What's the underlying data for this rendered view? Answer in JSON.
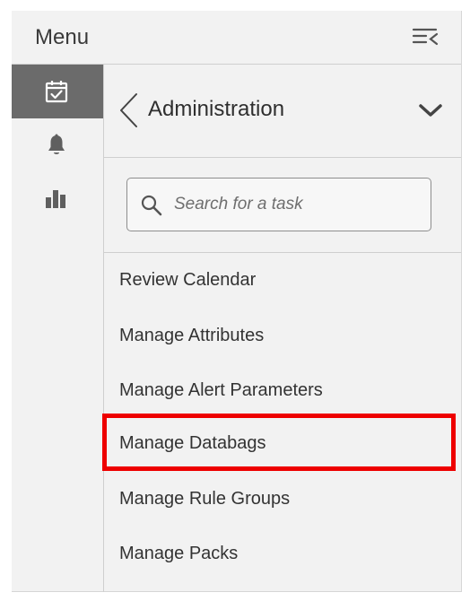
{
  "menu": {
    "title": "Menu",
    "collapse_icon": "list-collapse-icon"
  },
  "rail": {
    "items": [
      {
        "icon": "calendar-check-icon",
        "active": true
      },
      {
        "icon": "bell-icon",
        "active": false
      },
      {
        "icon": "bar-chart-icon",
        "active": false
      }
    ]
  },
  "section": {
    "title": "Administration",
    "back_icon": "chevron-left-icon",
    "expand_icon": "chevron-down-icon"
  },
  "search": {
    "placeholder": "Search for a task",
    "value": ""
  },
  "tasks": [
    {
      "label": "Review Calendar"
    },
    {
      "label": "Manage Attributes"
    },
    {
      "label": "Manage Alert Parameters"
    },
    {
      "label": "Manage Databags",
      "highlighted": true
    },
    {
      "label": "Manage Rule Groups"
    },
    {
      "label": "Manage Packs"
    }
  ],
  "colors": {
    "panel_bg": "#f2f2f2",
    "rail_active_bg": "#6b6b6b",
    "highlight": "#ee0000",
    "text": "#333333"
  }
}
